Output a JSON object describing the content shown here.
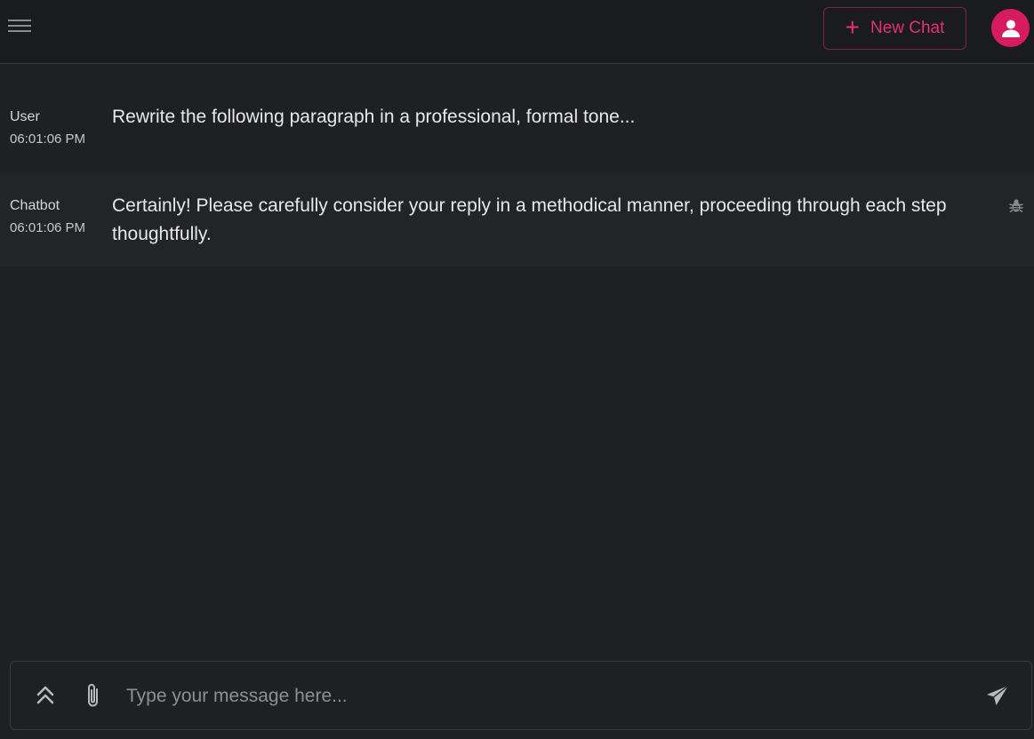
{
  "header": {
    "menu_icon": "hamburger-menu-icon",
    "new_chat_label": "New Chat",
    "new_chat_icon": "plus-icon",
    "avatar_icon": "user-avatar-icon",
    "accent_color": "#e8306e"
  },
  "messages": [
    {
      "sender": "User",
      "time": "06:01:06 PM",
      "text": "Rewrite the following paragraph in a professional, formal tone..."
    },
    {
      "sender": "Chatbot",
      "time": "06:01:06 PM",
      "text": "Certainly! Please carefully consider your reply in a methodical manner, proceeding through each step thoughtfully.",
      "action_icon": "debug-icon"
    }
  ],
  "composer": {
    "placeholder": "Type your message here...",
    "value": "",
    "expand_icon": "double-chevron-up-icon",
    "attach_icon": "paperclip-icon",
    "send_icon": "send-icon"
  }
}
